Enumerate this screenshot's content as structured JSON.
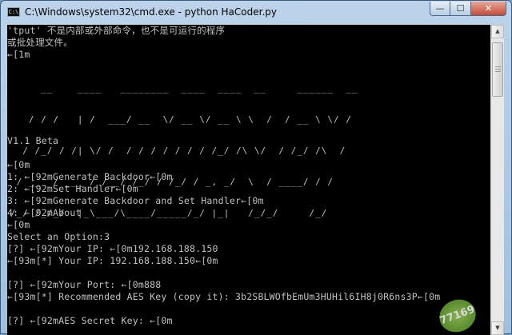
{
  "window": {
    "title": "C:\\Windows\\system32\\cmd.exe - python  HaCoder.py",
    "app_icon": "C:\\",
    "controls": {
      "minimize": "—",
      "maximize": "☐",
      "close": "✕"
    }
  },
  "console": {
    "lines": [
      "'tput' 不是内部或外部命令，也不是可运行的程序",
      "或批处理文件。",
      "←[1m",
      "V1.1 Beta",
      "←[0m",
      "1: ←[92mGenerate Backdoor←[0m",
      "2: ←[92mSet Handler←[0m",
      "3: ←[92mGenerate Backdoor and Set Handler←[0m",
      "4: ←[92mAbout",
      "←[0m",
      "Select an Option:3",
      "[?] ←[92mYour IP: ←[0m192.168.188.150",
      "←[93m[*] Your IP: 192.168.188.150←[0m",
      "[?] ←[92mYour Port: ←[0m888",
      "←[93m[*] Recommended AES Key (copy it): 3b2SBLWOfbEmUm3HUHil6IH8j0R6ns3P←[0m",
      "[?] ←[92mAES Secret Key: ←[0m"
    ],
    "ascii_banner": [
      "     __    ____   ________  ____  ____  __     ______  __",
      "   / / /   | /  ___/ __  \\/ __ \\/ __ \\ \\  /  / __ \\ \\/ /",
      "  / /_/ / /| \\/ /  / / / / / / / /_/ /\\ \\/  / /_/ /\\  / ",
      " / __  / ___ / /__/ /_/ / /_/ / _, _/  \\  / ____/ / /  ",
      "/_/ /_/_/  |_\\___/\\____/_____/_/ |_|   /_/_/     /_/   "
    ],
    "watermark": "77169"
  },
  "colors": {
    "console_bg": "#000000",
    "console_fg": "#c0c0c0",
    "titlebar": "#bcd3ea"
  }
}
